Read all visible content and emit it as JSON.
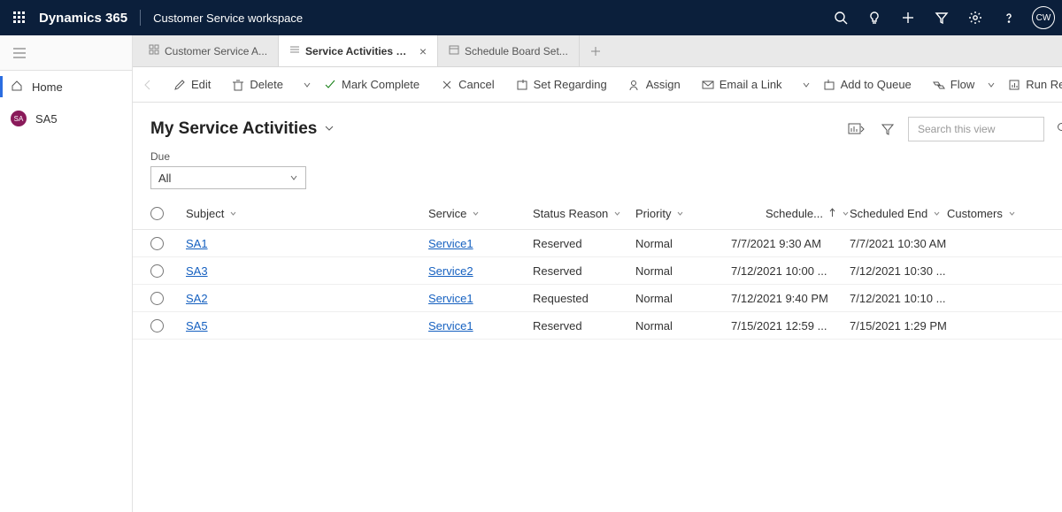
{
  "top": {
    "brand": "Dynamics 365",
    "app": "Customer Service workspace",
    "user_initials": "CW"
  },
  "left": {
    "home": "Home",
    "recent": "SA5",
    "recent_initials": "SA"
  },
  "tabs": {
    "t0": "Customer Service A...",
    "t1": "Service Activities My Ser...",
    "t2": "Schedule Board Set..."
  },
  "cmd": {
    "edit": "Edit",
    "delete": "Delete",
    "mark_complete": "Mark Complete",
    "cancel": "Cancel",
    "set_regarding": "Set Regarding",
    "assign": "Assign",
    "email_link": "Email a Link",
    "add_to_queue": "Add to Queue",
    "flow": "Flow",
    "run_report": "Run Report"
  },
  "view": {
    "title": "My Service Activities",
    "search_placeholder": "Search this view",
    "due_label": "Due",
    "due_value": "All"
  },
  "cols": {
    "subject": "Subject",
    "service": "Service",
    "status": "Status Reason",
    "priority": "Priority",
    "start": "Schedule...",
    "end": "Scheduled End",
    "customers": "Customers"
  },
  "rows": [
    {
      "subject": "SA1",
      "service": "Service1",
      "status": "Reserved",
      "priority": "Normal",
      "start": "7/7/2021 9:30 AM",
      "end": "7/7/2021 10:30 AM",
      "customers": ""
    },
    {
      "subject": "SA3",
      "service": "Service2",
      "status": "Reserved",
      "priority": "Normal",
      "start": "7/12/2021 10:00 ...",
      "end": "7/12/2021 10:30 ...",
      "customers": ""
    },
    {
      "subject": "SA2",
      "service": "Service1",
      "status": "Requested",
      "priority": "Normal",
      "start": "7/12/2021 9:40 PM",
      "end": "7/12/2021 10:10 ...",
      "customers": ""
    },
    {
      "subject": "SA5",
      "service": "Service1",
      "status": "Reserved",
      "priority": "Normal",
      "start": "7/15/2021 12:59 ...",
      "end": "7/15/2021 1:29 PM",
      "customers": ""
    }
  ]
}
